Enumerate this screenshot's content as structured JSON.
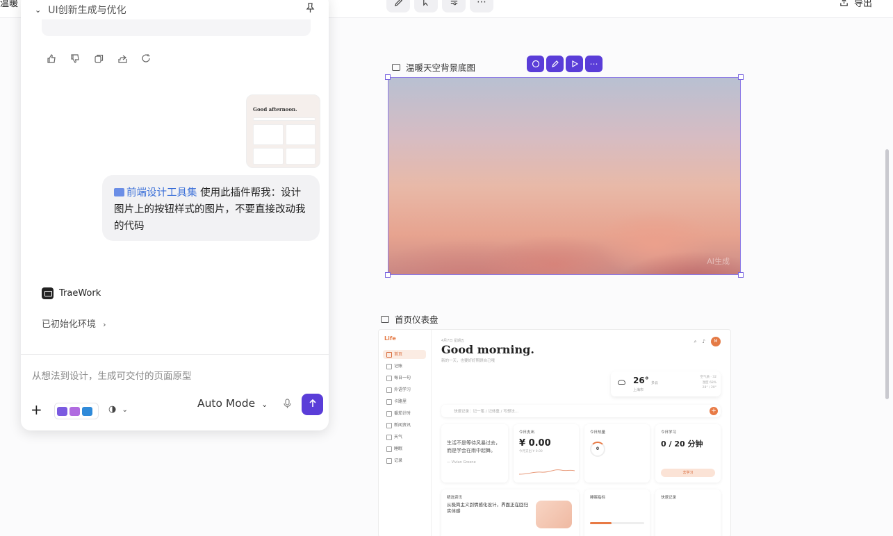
{
  "toolbar": {
    "doc_title": "温暖",
    "export_label": "导出"
  },
  "chat": {
    "header_title": "UI创新生成与优化",
    "user_message": {
      "plugin_name": "前端设计工具集",
      "text": "使用此插件帮我：设计图片上的按钮样式的图片，不要直接改动我的代码"
    },
    "thumbnail": {
      "headline": "Good afternoon."
    },
    "agent_name": "TraeWork",
    "status": "已初始化环境",
    "input_placeholder": "从想法到设计，生成可交付的页面原型",
    "mode": "Auto Mode"
  },
  "canvas": {
    "artboards": [
      {
        "title": "温暖天空背景底图",
        "watermark": "AI生成"
      },
      {
        "title": "首页仪表盘"
      }
    ],
    "dashboard": {
      "logo": "Life",
      "date": "4月7日 星期五",
      "greeting": "Good morning.",
      "subtitle": "新的一天，也要好好照顾自己哦",
      "avatar": "M",
      "nav": [
        "首页",
        "记账",
        "每日一句",
        "外语学习",
        "卡路里",
        "番茄计时",
        "新闻资讯",
        "天气",
        "睡眠",
        "记录"
      ],
      "weather": {
        "temp": "26°",
        "desc": "多云",
        "city": "上海市",
        "aqi": "空气质 · 32",
        "humidity": "湿度 68%",
        "range": "28° / 20°"
      },
      "quick_placeholder": "快速记录：记一笔 / 记体重 / 写想法...",
      "quote": "生活不是等待风暴过去，而是学会在雨中起舞。",
      "quote_author": "— Vivian Greene",
      "expense_title": "今日支出",
      "expense_value": "¥ 0.00",
      "expense_sub": "今月支出 ¥ 0.00",
      "calorie_title": "今日热量",
      "calorie_value": "0",
      "study_title": "今日学习",
      "study_value": "0 / 20 分钟",
      "study_button": "去学习",
      "news_title": "精选资讯",
      "news_headline": "从极简主义到情感化设计，界面正在回归实体感",
      "sleep_title": "睡眠指标",
      "todo_title": "快速记录"
    }
  }
}
